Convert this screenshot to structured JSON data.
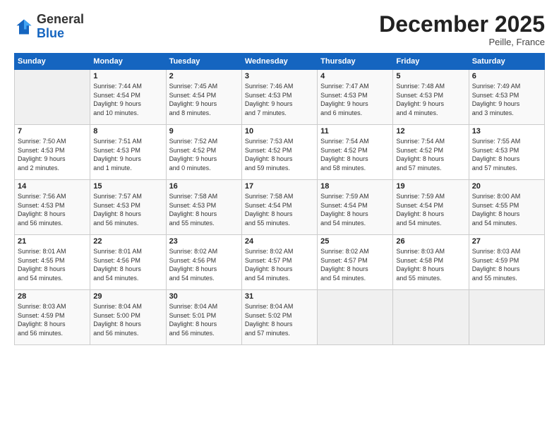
{
  "header": {
    "logo": {
      "line1": "General",
      "line2": "Blue"
    },
    "title": "December 2025",
    "subtitle": "Peille, France"
  },
  "weekdays": [
    "Sunday",
    "Monday",
    "Tuesday",
    "Wednesday",
    "Thursday",
    "Friday",
    "Saturday"
  ],
  "weeks": [
    [
      {
        "day": "",
        "info": ""
      },
      {
        "day": "1",
        "info": "Sunrise: 7:44 AM\nSunset: 4:54 PM\nDaylight: 9 hours\nand 10 minutes."
      },
      {
        "day": "2",
        "info": "Sunrise: 7:45 AM\nSunset: 4:54 PM\nDaylight: 9 hours\nand 8 minutes."
      },
      {
        "day": "3",
        "info": "Sunrise: 7:46 AM\nSunset: 4:53 PM\nDaylight: 9 hours\nand 7 minutes."
      },
      {
        "day": "4",
        "info": "Sunrise: 7:47 AM\nSunset: 4:53 PM\nDaylight: 9 hours\nand 6 minutes."
      },
      {
        "day": "5",
        "info": "Sunrise: 7:48 AM\nSunset: 4:53 PM\nDaylight: 9 hours\nand 4 minutes."
      },
      {
        "day": "6",
        "info": "Sunrise: 7:49 AM\nSunset: 4:53 PM\nDaylight: 9 hours\nand 3 minutes."
      }
    ],
    [
      {
        "day": "7",
        "info": "Sunrise: 7:50 AM\nSunset: 4:53 PM\nDaylight: 9 hours\nand 2 minutes."
      },
      {
        "day": "8",
        "info": "Sunrise: 7:51 AM\nSunset: 4:53 PM\nDaylight: 9 hours\nand 1 minute."
      },
      {
        "day": "9",
        "info": "Sunrise: 7:52 AM\nSunset: 4:52 PM\nDaylight: 9 hours\nand 0 minutes."
      },
      {
        "day": "10",
        "info": "Sunrise: 7:53 AM\nSunset: 4:52 PM\nDaylight: 8 hours\nand 59 minutes."
      },
      {
        "day": "11",
        "info": "Sunrise: 7:54 AM\nSunset: 4:52 PM\nDaylight: 8 hours\nand 58 minutes."
      },
      {
        "day": "12",
        "info": "Sunrise: 7:54 AM\nSunset: 4:52 PM\nDaylight: 8 hours\nand 57 minutes."
      },
      {
        "day": "13",
        "info": "Sunrise: 7:55 AM\nSunset: 4:53 PM\nDaylight: 8 hours\nand 57 minutes."
      }
    ],
    [
      {
        "day": "14",
        "info": "Sunrise: 7:56 AM\nSunset: 4:53 PM\nDaylight: 8 hours\nand 56 minutes."
      },
      {
        "day": "15",
        "info": "Sunrise: 7:57 AM\nSunset: 4:53 PM\nDaylight: 8 hours\nand 56 minutes."
      },
      {
        "day": "16",
        "info": "Sunrise: 7:58 AM\nSunset: 4:53 PM\nDaylight: 8 hours\nand 55 minutes."
      },
      {
        "day": "17",
        "info": "Sunrise: 7:58 AM\nSunset: 4:54 PM\nDaylight: 8 hours\nand 55 minutes."
      },
      {
        "day": "18",
        "info": "Sunrise: 7:59 AM\nSunset: 4:54 PM\nDaylight: 8 hours\nand 54 minutes."
      },
      {
        "day": "19",
        "info": "Sunrise: 7:59 AM\nSunset: 4:54 PM\nDaylight: 8 hours\nand 54 minutes."
      },
      {
        "day": "20",
        "info": "Sunrise: 8:00 AM\nSunset: 4:55 PM\nDaylight: 8 hours\nand 54 minutes."
      }
    ],
    [
      {
        "day": "21",
        "info": "Sunrise: 8:01 AM\nSunset: 4:55 PM\nDaylight: 8 hours\nand 54 minutes."
      },
      {
        "day": "22",
        "info": "Sunrise: 8:01 AM\nSunset: 4:56 PM\nDaylight: 8 hours\nand 54 minutes."
      },
      {
        "day": "23",
        "info": "Sunrise: 8:02 AM\nSunset: 4:56 PM\nDaylight: 8 hours\nand 54 minutes."
      },
      {
        "day": "24",
        "info": "Sunrise: 8:02 AM\nSunset: 4:57 PM\nDaylight: 8 hours\nand 54 minutes."
      },
      {
        "day": "25",
        "info": "Sunrise: 8:02 AM\nSunset: 4:57 PM\nDaylight: 8 hours\nand 54 minutes."
      },
      {
        "day": "26",
        "info": "Sunrise: 8:03 AM\nSunset: 4:58 PM\nDaylight: 8 hours\nand 55 minutes."
      },
      {
        "day": "27",
        "info": "Sunrise: 8:03 AM\nSunset: 4:59 PM\nDaylight: 8 hours\nand 55 minutes."
      }
    ],
    [
      {
        "day": "28",
        "info": "Sunrise: 8:03 AM\nSunset: 4:59 PM\nDaylight: 8 hours\nand 56 minutes."
      },
      {
        "day": "29",
        "info": "Sunrise: 8:04 AM\nSunset: 5:00 PM\nDaylight: 8 hours\nand 56 minutes."
      },
      {
        "day": "30",
        "info": "Sunrise: 8:04 AM\nSunset: 5:01 PM\nDaylight: 8 hours\nand 56 minutes."
      },
      {
        "day": "31",
        "info": "Sunrise: 8:04 AM\nSunset: 5:02 PM\nDaylight: 8 hours\nand 57 minutes."
      },
      {
        "day": "",
        "info": ""
      },
      {
        "day": "",
        "info": ""
      },
      {
        "day": "",
        "info": ""
      }
    ]
  ]
}
